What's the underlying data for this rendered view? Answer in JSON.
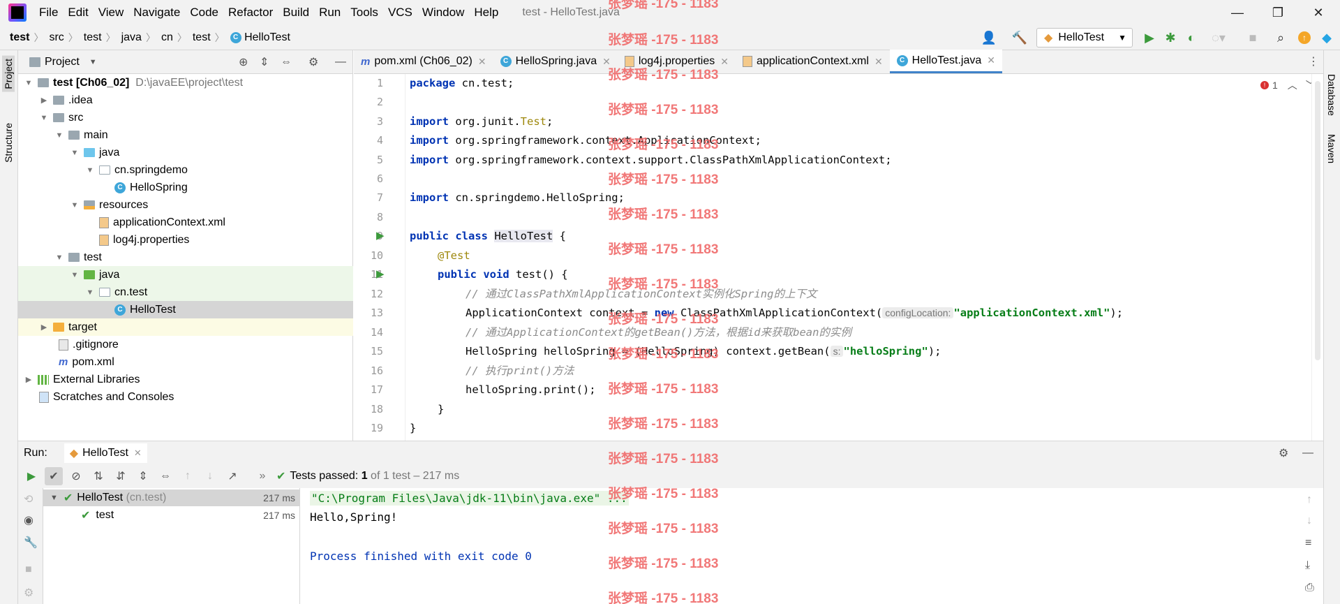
{
  "window": {
    "title": "test - HelloTest.java"
  },
  "menu": [
    "File",
    "Edit",
    "View",
    "Navigate",
    "Code",
    "Refactor",
    "Build",
    "Run",
    "Tools",
    "VCS",
    "Window",
    "Help"
  ],
  "breadcrumb": [
    "test",
    "src",
    "test",
    "java",
    "cn",
    "test",
    "HelloTest"
  ],
  "toolbar": {
    "run_config": "HelloTest"
  },
  "project_panel": {
    "title": "Project",
    "tree": [
      {
        "label": "test [Ch06_02]",
        "path": "D:\\javaEE\\project\\test"
      },
      {
        "label": ".idea"
      },
      {
        "label": "src"
      },
      {
        "label": "main"
      },
      {
        "label": "java"
      },
      {
        "label": "cn.springdemo"
      },
      {
        "label": "HelloSpring"
      },
      {
        "label": "resources"
      },
      {
        "label": "applicationContext.xml"
      },
      {
        "label": "log4j.properties"
      },
      {
        "label": "test"
      },
      {
        "label": "java"
      },
      {
        "label": "cn.test"
      },
      {
        "label": "HelloTest"
      },
      {
        "label": "target"
      },
      {
        "label": ".gitignore"
      },
      {
        "label": "pom.xml"
      },
      {
        "label": "External Libraries"
      },
      {
        "label": "Scratches and Consoles"
      }
    ]
  },
  "left_stripe": {
    "project": "Project",
    "structure": "Structure"
  },
  "right_stripe": {
    "database": "Database",
    "maven": "Maven"
  },
  "tabs": [
    "pom.xml (Ch06_02)",
    "HelloSpring.java",
    "log4j.properties",
    "applicationContext.xml",
    "HelloTest.java"
  ],
  "editor": {
    "error_count": "1",
    "line_numbers": [
      "1",
      "2",
      "3",
      "4",
      "5",
      "6",
      "7",
      "8",
      "9",
      "10",
      "11",
      "12",
      "13",
      "14",
      "15",
      "16",
      "17",
      "18",
      "19"
    ],
    "l1_kw": "package",
    "l1": " cn.test;",
    "l3_kw": "import",
    "l3": " org.junit.",
    "l3_ann": "Test",
    ";": ";",
    "l4_kw": "import",
    "l4": " org.springframework.context.ApplicationContext;",
    "l5_kw": "import",
    "l5": " org.springframework.context.support.ClassPathXmlApplicationContext;",
    "l7_kw": "import",
    "l7": " cn.springdemo.HelloSpring;",
    "l9_kw": "public class",
    "l9_cls": "HelloTest",
    "l9_end": " {",
    "l10_ann": "@Test",
    "l11_kw": "public void",
    "l11": " test() {",
    "l12_cmt": "// 通过ClassPathXmlApplicationContext实例化Spring的上下文",
    "l13_a": "ApplicationContext context = ",
    "l13_kw": "new",
    "l13_b": " ClassPathXmlApplicationContext(",
    "l13_hint": "configLocation:",
    "l13_str": "\"applicationContext.xml\"",
    "l13_end": ");",
    "l14_cmt": "// 通过ApplicationContext的getBean()方法，根据id来获取bean的实例",
    "l15_a": "HelloSpring helloSpring = (HelloSpring) context.getBean(",
    "l15_hint": "s:",
    "l15_str": "\"helloSpring\"",
    "l15_end": ");",
    "l16_cmt": "// 执行print()方法",
    "l17": "helloSpring.print();",
    "l18": "}",
    "l19": "}"
  },
  "run_panel": {
    "label": "Run:",
    "tab": "HelloTest",
    "status_prefix": "Tests passed:",
    "status_count": "1",
    "status_suffix": "of 1 test – 217 ms",
    "tree": [
      {
        "name": "HelloTest",
        "pkg": "(cn.test)",
        "time": "217 ms"
      },
      {
        "name": "test",
        "time": "217 ms"
      }
    ],
    "console": [
      "\"C:\\Program Files\\Java\\jdk-11\\bin\\java.exe\" ...",
      "Hello,Spring!",
      "",
      "Process finished with exit code 0"
    ]
  },
  "watermark": "张梦瑶 -175 - 1183",
  "colors": {
    "keyword": "#0033b3",
    "string": "#067d17",
    "annotation": "#9e880d",
    "comment": "#8c8c8c",
    "console_exit": "#0033b3",
    "watermark": "#f06a6a"
  }
}
